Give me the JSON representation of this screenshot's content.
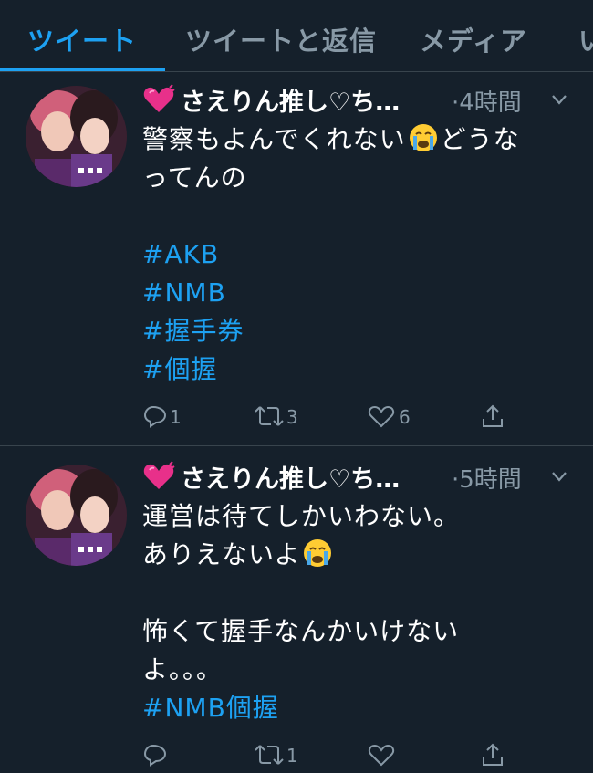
{
  "tabs": [
    {
      "label": "ツイート",
      "active": true
    },
    {
      "label": "ツイートと返信",
      "active": false
    },
    {
      "label": "メディア",
      "active": false
    },
    {
      "label": "い",
      "active": false
    }
  ],
  "tweets": [
    {
      "author": "さえりん推し♡ち…",
      "time": "·4時間",
      "lines": [
        {
          "parts": [
            {
              "t": "警察もよんでくれない"
            },
            {
              "emoji": "crying-face-icon"
            },
            {
              "t": "どうな"
            }
          ]
        },
        {
          "parts": [
            {
              "t": "ってんの"
            }
          ]
        },
        {
          "parts": [
            {
              "t": ""
            }
          ]
        },
        {
          "parts": [
            {
              "t": "#AKB",
              "tag": true
            }
          ]
        },
        {
          "parts": [
            {
              "t": "#NMB",
              "tag": true
            }
          ]
        },
        {
          "parts": [
            {
              "t": "#握手券",
              "tag": true
            }
          ]
        },
        {
          "parts": [
            {
              "t": "#個握",
              "tag": true
            }
          ]
        }
      ],
      "replies": "1",
      "retweets": "3",
      "likes": "6"
    },
    {
      "author": "さえりん推し♡ち…",
      "time": "·5時間",
      "lines": [
        {
          "parts": [
            {
              "t": "運営は待てしかいわない。"
            }
          ]
        },
        {
          "parts": [
            {
              "t": "ありえないよ"
            },
            {
              "emoji": "crying-face-icon"
            }
          ]
        },
        {
          "parts": [
            {
              "t": ""
            }
          ]
        },
        {
          "parts": [
            {
              "t": "怖くて握手なんかいけない"
            }
          ]
        },
        {
          "parts": [
            {
              "t": "よ。。。"
            }
          ]
        },
        {
          "parts": [
            {
              "t": "#NMB個握",
              "tag": true
            }
          ]
        }
      ],
      "replies": "",
      "retweets": "1",
      "likes": ""
    }
  ],
  "colors": {
    "background": "#15202b",
    "accent": "#1da1f2",
    "muted": "#8899a6",
    "divider": "#38444d"
  }
}
